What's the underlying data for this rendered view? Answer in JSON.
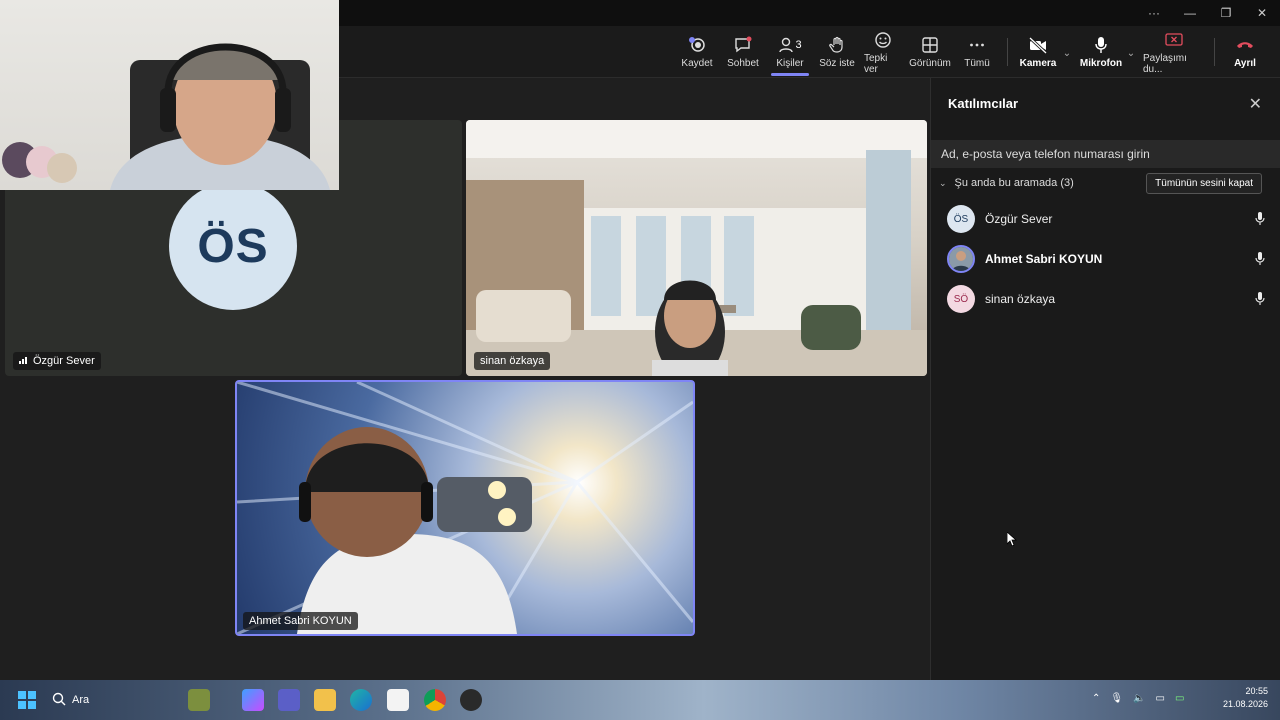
{
  "window": {
    "more": "···",
    "minimize": "—",
    "maximize": "❐",
    "close": "✕"
  },
  "toolbar": {
    "record": "Kaydet",
    "chat": "Sohbet",
    "people": "Kişiler",
    "people_count": "3",
    "raise_hand": "Söz iste",
    "react": "Tepki ver",
    "view": "Görünüm",
    "more": "Tümü",
    "camera": "Kamera",
    "mic": "Mikrofon",
    "share": "Paylaşımı du...",
    "leave": "Ayrıl"
  },
  "tiles": {
    "ozgur": {
      "name": "Özgür Sever",
      "initials": "ÖS"
    },
    "sinan": {
      "name": "sinan özkaya"
    },
    "ahmet": {
      "name": "Ahmet Sabri KOYUN"
    }
  },
  "panel": {
    "title": "Katılımcılar",
    "search_placeholder": "Ad, e-posta veya telefon numarası girin",
    "group_label": "Şu anda bu aramada (3)",
    "mute_all": "Tümünün sesini kapat",
    "participants": [
      {
        "initials": "ÖS",
        "name": "Özgür Sever",
        "avatar_bg": "#dde6f0",
        "avatar_fg": "#1d3a5c"
      },
      {
        "initials": "",
        "name": "Ahmet Sabri KOYUN",
        "avatar_bg": "#3a4a5a",
        "avatar_fg": "#ffffff"
      },
      {
        "initials": "SÖ",
        "name": "sinan özkaya",
        "avatar_bg": "#f3d9e2",
        "avatar_fg": "#9b2a4e"
      }
    ]
  },
  "taskbar": {
    "search": "Ara",
    "time": "20:55",
    "date": "21.08.2026"
  },
  "colors": {
    "accent": "#7f85f5",
    "leave": "#e34d5e",
    "share": "#e34d5e"
  }
}
